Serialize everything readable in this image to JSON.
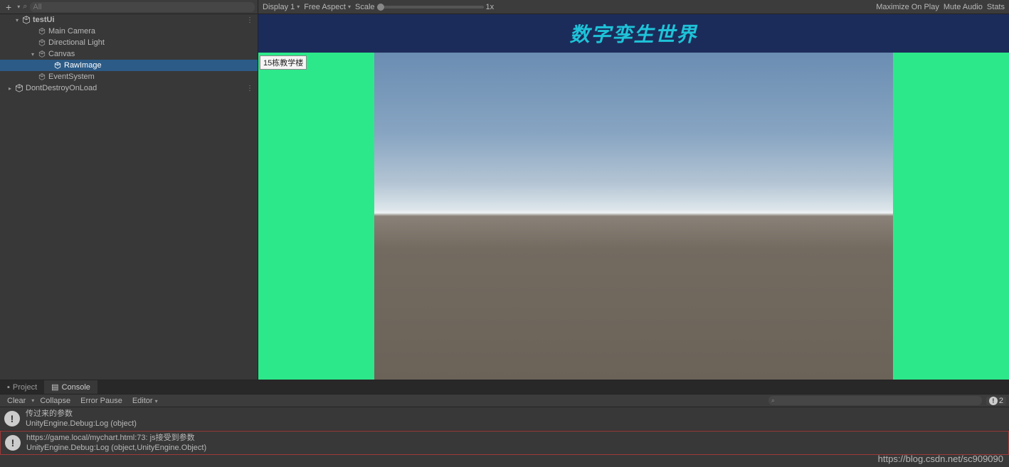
{
  "hierarchy": {
    "search_placeholder": "All",
    "items": [
      {
        "label": "testUi",
        "type": "scene",
        "depth": 0,
        "expanded": true,
        "kebab": true
      },
      {
        "label": "Main Camera",
        "type": "object",
        "depth": 1
      },
      {
        "label": "Directional Light",
        "type": "object",
        "depth": 1
      },
      {
        "label": "Canvas",
        "type": "object",
        "depth": 1,
        "expanded": true
      },
      {
        "label": "RawImage",
        "type": "object",
        "depth": 2,
        "selected": true
      },
      {
        "label": "EventSystem",
        "type": "object",
        "depth": 1
      },
      {
        "label": "DontDestroyOnLoad",
        "type": "scene",
        "depth": 0,
        "kebab": true
      }
    ]
  },
  "game_toolbar": {
    "display": "Display 1",
    "aspect": "Free Aspect",
    "scale_label": "Scale",
    "scale_value": "1x",
    "maximize": "Maximize On Play",
    "mute": "Mute Audio",
    "stats": "Stats"
  },
  "game_view": {
    "title": "数字孪生世界",
    "label_tag": "15栋教学楼"
  },
  "bottom_tabs": {
    "project": "Project",
    "console": "Console"
  },
  "console_toolbar": {
    "clear": "Clear",
    "collapse": "Collapse",
    "error_pause": "Error Pause",
    "editor": "Editor",
    "info_count": "2"
  },
  "console_logs": [
    {
      "line1": "传过来的参数",
      "line2": "UnityEngine.Debug:Log (object)",
      "highlighted": false
    },
    {
      "line1": "https://game.local/mychart.html:73: js接受到参数",
      "line2": "UnityEngine.Debug:Log (object,UnityEngine.Object)",
      "highlighted": true
    }
  ],
  "watermark": "https://blog.csdn.net/sc909090"
}
